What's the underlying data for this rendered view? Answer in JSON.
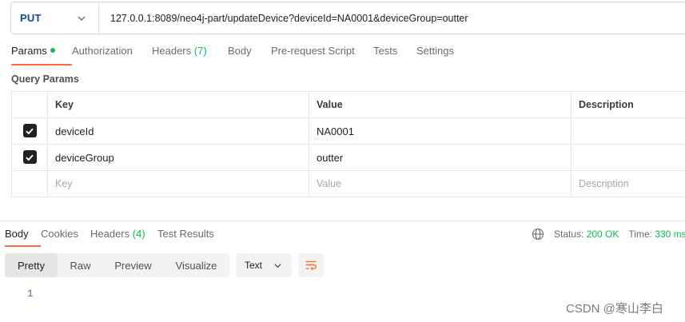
{
  "request": {
    "method": "PUT",
    "url": "127.0.0.1:8089/neo4j-part/updateDevice?deviceId=NA0001&deviceGroup=outter"
  },
  "request_tabs": [
    {
      "label": "Params",
      "active": true,
      "dot": true
    },
    {
      "label": "Authorization"
    },
    {
      "label": "Headers",
      "count": "(7)"
    },
    {
      "label": "Body"
    },
    {
      "label": "Pre-request Script"
    },
    {
      "label": "Tests"
    },
    {
      "label": "Settings"
    }
  ],
  "query_params": {
    "title": "Query Params",
    "headers": {
      "key": "Key",
      "value": "Value",
      "description": "Description"
    },
    "rows": [
      {
        "checked": true,
        "key": "deviceId",
        "value": "NA0001",
        "description": ""
      },
      {
        "checked": true,
        "key": "deviceGroup",
        "value": "outter",
        "description": ""
      }
    ],
    "placeholder": {
      "key": "Key",
      "value": "Value",
      "description": "Description"
    }
  },
  "response_tabs": [
    {
      "label": "Body",
      "active": true
    },
    {
      "label": "Cookies"
    },
    {
      "label": "Headers",
      "count": "(4)"
    },
    {
      "label": "Test Results"
    }
  ],
  "response_status": {
    "status_label": "Status:",
    "status_value": "200 OK",
    "time_label": "Time:",
    "time_value": "330 ms"
  },
  "view_modes": [
    "Pretty",
    "Raw",
    "Preview",
    "Visualize"
  ],
  "format": "Text",
  "body_line_number": "1",
  "watermark": "CSDN @寒山李白",
  "colors": {
    "accent": "#ff6c37",
    "success": "#0cbb52",
    "method": "#0d4b9c"
  }
}
